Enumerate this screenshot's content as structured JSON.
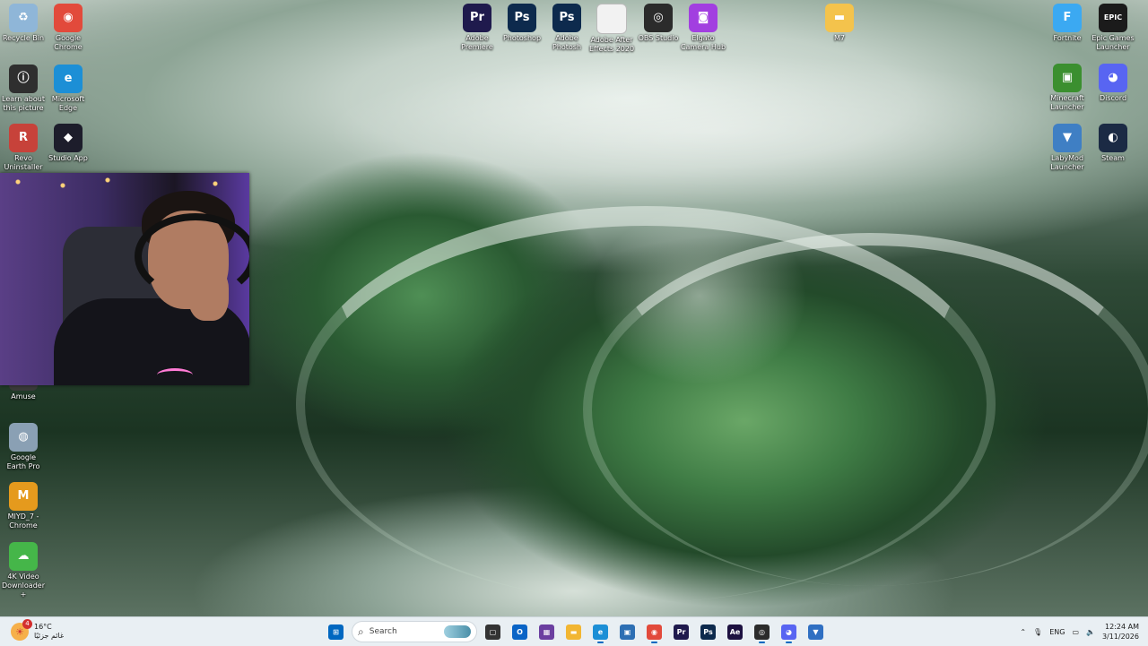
{
  "desktop": {
    "icons": [
      {
        "name": "recycle-bin-icon",
        "label": "Recycle Bin",
        "glyph": "♻",
        "color": "#8fb6d8"
      },
      {
        "name": "google-chrome-icon",
        "label": "Google Chrome",
        "glyph": "◉",
        "color": "#e24a3b"
      },
      {
        "name": "learn-about-picture-icon",
        "label": "Learn about this picture",
        "glyph": "ⓘ",
        "color": "#2f2f2f"
      },
      {
        "name": "microsoft-edge-icon",
        "label": "Microsoft Edge",
        "glyph": "e",
        "color": "#1c8fd6"
      },
      {
        "name": "revo-uninstaller-icon",
        "label": "Revo Uninstaller",
        "glyph": "R",
        "color": "#c7423a"
      },
      {
        "name": "studio-app-icon",
        "label": "Studio App",
        "glyph": "◆",
        "color": "#1d1d2b"
      },
      {
        "name": "amuse-icon",
        "label": "Amuse",
        "glyph": "A",
        "color": "#3a3a3a"
      },
      {
        "name": "google-earth-pro-icon",
        "label": "Google Earth Pro",
        "glyph": "◍",
        "color": "#8aa0b4"
      },
      {
        "name": "miyd-chrome-icon",
        "label": "MIYD_7 - Chrome",
        "glyph": "M",
        "color": "#e59a1d"
      },
      {
        "name": "4k-video-downloader-icon",
        "label": "4K Video Downloader+",
        "glyph": "☁",
        "color": "#45b649"
      },
      {
        "name": "adobe-premiere-icon",
        "label": "Adobe Premiere",
        "glyph": "Pr",
        "color": "#1f1a4d"
      },
      {
        "name": "photoshop-icon",
        "label": "Photoshop",
        "glyph": "Ps",
        "color": "#0d2a4d"
      },
      {
        "name": "adobe-photoshop-icon",
        "label": "Adobe Photosh",
        "glyph": "Ps",
        "color": "#0d2a4d"
      },
      {
        "name": "adobe-after-effects-icon",
        "label": "Adobe After Effects 2020",
        "glyph": "",
        "color": "#f2f2f2"
      },
      {
        "name": "obs-studio-icon",
        "label": "OBS Studio",
        "glyph": "◎",
        "color": "#2b2b2b"
      },
      {
        "name": "elgato-camera-hub-icon",
        "label": "Elgato Camera Hub",
        "glyph": "◙",
        "color": "#a23fe0"
      },
      {
        "name": "folder-icon",
        "label": "M7",
        "glyph": "▬",
        "color": "#f4c34c"
      },
      {
        "name": "fortnite-icon",
        "label": "Fortnite",
        "glyph": "F",
        "color": "#3ba9f2"
      },
      {
        "name": "epic-games-launcher-icon",
        "label": "Epic Games Launcher",
        "glyph": "EPIC",
        "color": "#1b1b1b"
      },
      {
        "name": "minecraft-launcher-icon",
        "label": "Minecraft Launcher",
        "glyph": "▣",
        "color": "#3b8f2f"
      },
      {
        "name": "discord-icon",
        "label": "Discord",
        "glyph": "◕",
        "color": "#5865f2"
      },
      {
        "name": "labymod-launcher-icon",
        "label": "LabyMod Launcher",
        "glyph": "▼",
        "color": "#3f7fc4"
      },
      {
        "name": "steam-icon",
        "label": "Steam",
        "glyph": "◐",
        "color": "#1b2a44"
      }
    ]
  },
  "taskbar": {
    "weather": {
      "temp": "16°C",
      "desc": "غائم جزئيًا",
      "badge": "4"
    },
    "search_label": "Search",
    "apps": [
      {
        "name": "start-button",
        "glyph": "⊞",
        "color": "#0067c0"
      },
      {
        "name": "task-view-icon",
        "glyph": "▢",
        "color": "#333"
      },
      {
        "name": "outlook-icon",
        "glyph": "O",
        "color": "#0a64c6"
      },
      {
        "name": "microsoft-store-icon",
        "glyph": "▦",
        "color": "#6b3fa0"
      },
      {
        "name": "file-explorer-icon",
        "glyph": "▬",
        "color": "#f2b632"
      },
      {
        "name": "edge-taskbar-icon",
        "glyph": "e",
        "color": "#1c8fd6"
      },
      {
        "name": "teams-icon",
        "glyph": "▣",
        "color": "#2d6fb3"
      },
      {
        "name": "chrome-taskbar-icon",
        "glyph": "◉",
        "color": "#e24a3b"
      },
      {
        "name": "premiere-taskbar-icon",
        "glyph": "Pr",
        "color": "#1f1a4d"
      },
      {
        "name": "photoshop-taskbar-icon",
        "glyph": "Ps",
        "color": "#0d2a4d"
      },
      {
        "name": "after-effects-taskbar-icon",
        "glyph": "Ae",
        "color": "#1d1140"
      },
      {
        "name": "obs-taskbar-icon",
        "glyph": "◎",
        "color": "#2b2b2b"
      },
      {
        "name": "discord-taskbar-icon",
        "glyph": "◕",
        "color": "#5865f2"
      },
      {
        "name": "vpn-shield-icon",
        "glyph": "▼",
        "color": "#2f6fc2"
      }
    ],
    "tray": {
      "lang": "ENG",
      "time": "12:24 AM",
      "date": "3/11/2026"
    }
  }
}
